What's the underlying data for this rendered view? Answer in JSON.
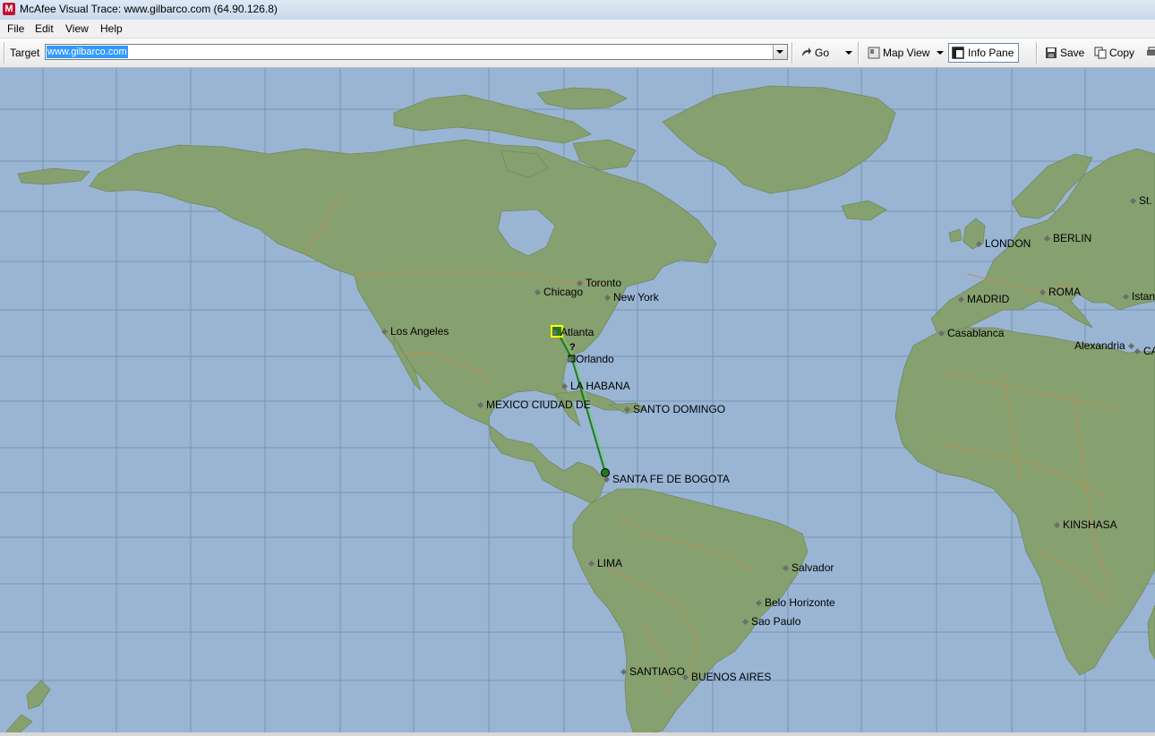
{
  "window": {
    "title": "McAfee Visual Trace: www.gilbarco.com (64.90.126.8)",
    "icon": "M"
  },
  "menu": [
    "File",
    "Edit",
    "View",
    "Help"
  ],
  "toolbar": {
    "target_label": "Target",
    "target_value": "www.gilbarco.com",
    "go_label": "Go",
    "map_view_label": "Map View",
    "info_pane_label": "Info Pane",
    "save_label": "Save",
    "copy_label": "Copy"
  },
  "trace": {
    "hop_marker": "?"
  },
  "cities": [
    "Toronto",
    "Chicago",
    "New York",
    "Los Angeles",
    "Atlanta",
    "Orlando",
    "LA HABANA",
    "MEXICO CIUDAD DE",
    "SANTO DOMINGO",
    "SANTA FE DE BOGOTA",
    "LIMA",
    "Salvador",
    "Belo Horizonte",
    "Sao Paulo",
    "SANTIAGO",
    "BUENOS AIRES",
    "LONDON",
    "BERLIN",
    "MADRID",
    "ROMA",
    "Casablanca",
    "Alexandria",
    "KINSHASA",
    "St.",
    "Istan",
    "CA"
  ],
  "colors": {
    "ocean": "#9ab5d4",
    "land": "#86a070",
    "border": "#c98a4a",
    "trace": "#1f7a1f"
  }
}
